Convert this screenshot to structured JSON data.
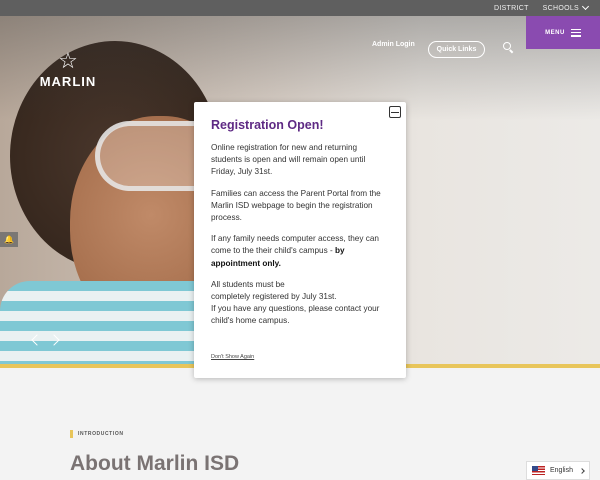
{
  "utility_bar": {
    "district": "DISTRICT",
    "schools": "SCHOOLS"
  },
  "header": {
    "logo_text": "MARLIN",
    "admin_login": "Admin Login",
    "quick_links": "Quick Links",
    "menu": "MENU"
  },
  "modal": {
    "title": "Registration Open!",
    "p1": "Online registration for new and returning students is open and will remain open until Friday, July 31st.",
    "p2": "Families can access the Parent Portal from the Marlin ISD webpage to begin the registration process.",
    "p3_text": "If any family needs computer access, they can come to the their child's campus - ",
    "p3_bold": "by appointment only.",
    "p4_line1": "All students must be",
    "p4_line2": "completely registered by July 31st.",
    "p4_line3": "If you have any questions, please contact your child's home campus.",
    "dismiss": "Don't Show Again"
  },
  "intro": {
    "tag": "INTRODUCTION",
    "title": "About Marlin ISD"
  },
  "language": {
    "label": "English"
  },
  "colors": {
    "accent_purple": "#8a4bb0",
    "title_purple": "#5e2a84",
    "gold": "#e8c55a"
  }
}
